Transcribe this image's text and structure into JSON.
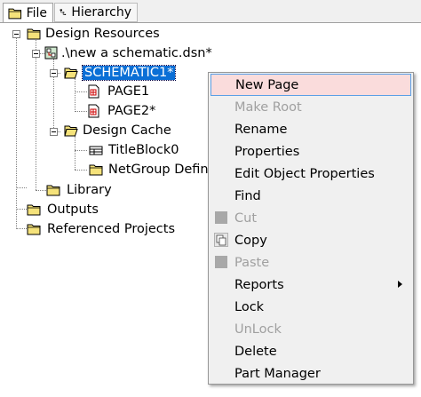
{
  "tabs": [
    {
      "label": "File",
      "icon": "folder-icon"
    },
    {
      "label": "Hierarchy",
      "icon": "hierarchy-icon"
    }
  ],
  "tree": {
    "design_resources": "Design Resources",
    "design_file": ".\\new a schematic.dsn*",
    "schematic": "SCHEMATIC1*",
    "page1": "PAGE1",
    "page2": "PAGE2*",
    "design_cache": "Design Cache",
    "titleblock": "TitleBlock0",
    "netgroup": "NetGroup Defin",
    "library": "Library",
    "outputs": "Outputs",
    "referenced_projects": "Referenced Projects"
  },
  "context_menu": {
    "items": [
      {
        "label": "New Page",
        "enabled": true,
        "highlighted": true
      },
      {
        "label": "Make Root",
        "enabled": false
      },
      {
        "label": "Rename",
        "enabled": true
      },
      {
        "label": "Properties",
        "enabled": true
      },
      {
        "label": "Edit Object Properties",
        "enabled": true
      },
      {
        "label": "Find",
        "enabled": true
      },
      {
        "label": "Cut",
        "enabled": false,
        "icon": "cut-icon"
      },
      {
        "label": "Copy",
        "enabled": true,
        "icon": "copy-icon"
      },
      {
        "label": "Paste",
        "enabled": false,
        "icon": "paste-icon"
      },
      {
        "label": "Reports",
        "enabled": true,
        "submenu": true
      },
      {
        "label": "Lock",
        "enabled": true
      },
      {
        "label": "UnLock",
        "enabled": false
      },
      {
        "label": "Delete",
        "enabled": true
      },
      {
        "label": "Part Manager",
        "enabled": true
      }
    ]
  },
  "colors": {
    "selection": "#0a6fd6",
    "menu_highlight": "#fadcdc",
    "menu_highlight_border": "#5aa0e6",
    "folder_yellow": "#f5e27a"
  }
}
